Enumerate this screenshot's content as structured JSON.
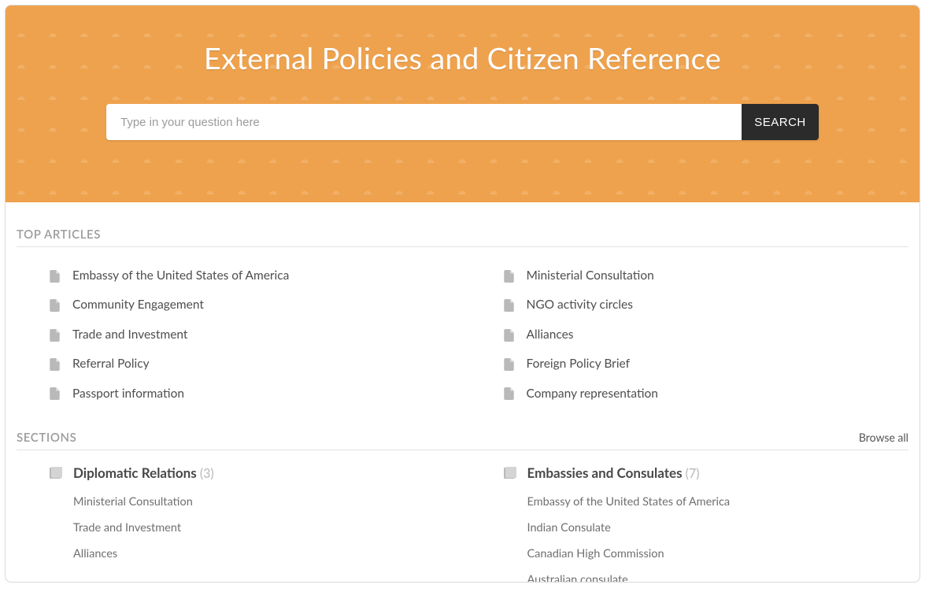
{
  "hero": {
    "title": "External Policies and Citizen Reference",
    "search_placeholder": "Type in your question here",
    "search_button": "SEARCH"
  },
  "top_articles": {
    "heading": "TOP ARTICLES",
    "left": [
      "Embassy of the United States of America",
      "Community Engagement",
      "Trade and Investment",
      "Referral Policy",
      "Passport information"
    ],
    "right": [
      "Ministerial Consultation",
      "NGO activity circles",
      "Alliances",
      "Foreign Policy Brief",
      "Company representation"
    ]
  },
  "sections": {
    "heading": "SECTIONS",
    "browse_all": "Browse all",
    "left": {
      "name": "Diplomatic Relations",
      "count": "(3)",
      "items": [
        "Ministerial Consultation",
        "Trade and Investment",
        "Alliances"
      ]
    },
    "right": {
      "name": "Embassies and Consulates",
      "count": "(7)",
      "items": [
        "Embassy of the United States of America",
        "Indian Consulate",
        "Canadian High Commission",
        "Australian consulate"
      ]
    }
  }
}
